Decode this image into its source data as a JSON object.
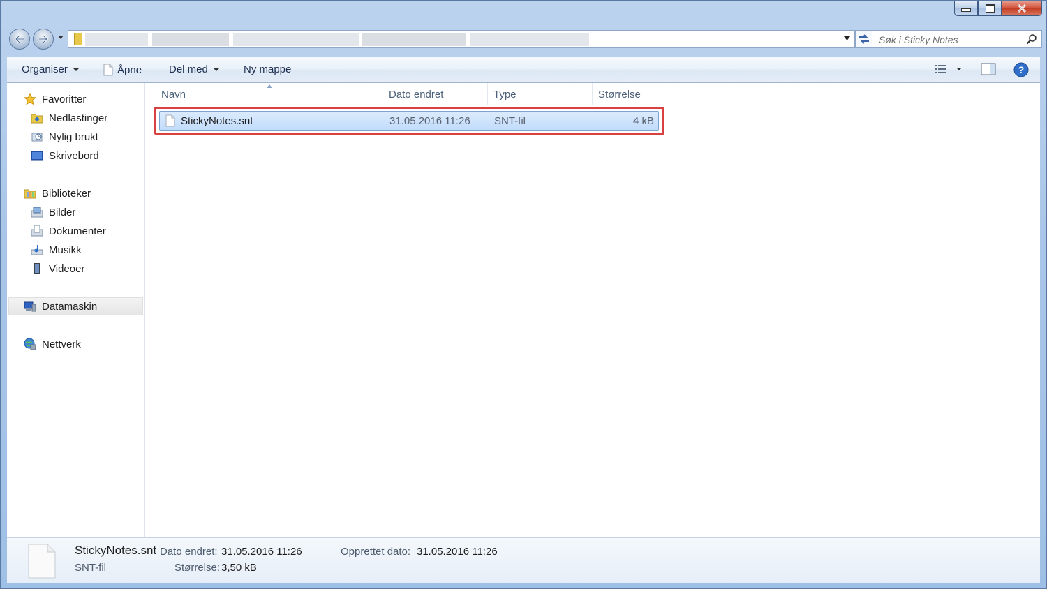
{
  "window": {
    "caption_buttons": {
      "minimize": "minimize-icon",
      "maximize": "maximize-icon",
      "close": "close-icon"
    }
  },
  "navigation": {
    "address_path": "",
    "search_placeholder": "Søk i Sticky Notes"
  },
  "toolbar": {
    "organize_label": "Organiser",
    "open_label": "Åpne",
    "share_label": "Del med",
    "new_folder_label": "Ny mappe"
  },
  "sidebar": {
    "favorites": {
      "label": "Favoritter",
      "icon": "star-icon"
    },
    "favorites_items": [
      {
        "label": "Nedlastinger",
        "icon": "downloads-folder-icon"
      },
      {
        "label": "Nylig brukt",
        "icon": "recent-places-icon"
      },
      {
        "label": "Skrivebord",
        "icon": "desktop-icon"
      }
    ],
    "libraries": {
      "label": "Biblioteker",
      "icon": "libraries-icon"
    },
    "libraries_items": [
      {
        "label": "Bilder",
        "icon": "pictures-icon"
      },
      {
        "label": "Dokumenter",
        "icon": "documents-icon"
      },
      {
        "label": "Musikk",
        "icon": "music-icon"
      },
      {
        "label": "Videoer",
        "icon": "videos-icon"
      }
    ],
    "computer": {
      "label": "Datamaskin",
      "icon": "computer-icon"
    },
    "network": {
      "label": "Nettverk",
      "icon": "network-icon"
    }
  },
  "file_list": {
    "columns": [
      "Navn",
      "Dato endret",
      "Type",
      "Størrelse"
    ],
    "rows": [
      {
        "name": "StickyNotes.snt",
        "modified": "31.05.2016 11:26",
        "type": "SNT-fil",
        "size": "4 kB"
      }
    ]
  },
  "details": {
    "name": "StickyNotes.snt",
    "type": "SNT-fil",
    "modified_label": "Dato endret:",
    "modified_value": "31.05.2016 11:26",
    "size_label": "Størrelse:",
    "size_value": "3,50 kB",
    "created_label": "Opprettet dato:",
    "created_value": "31.05.2016 11:26"
  },
  "colors": {
    "selection_fill": "#c9e0fc",
    "selection_border": "#7da2ce",
    "highlight_outline": "#d94141",
    "frame": "#a9c6e8"
  }
}
